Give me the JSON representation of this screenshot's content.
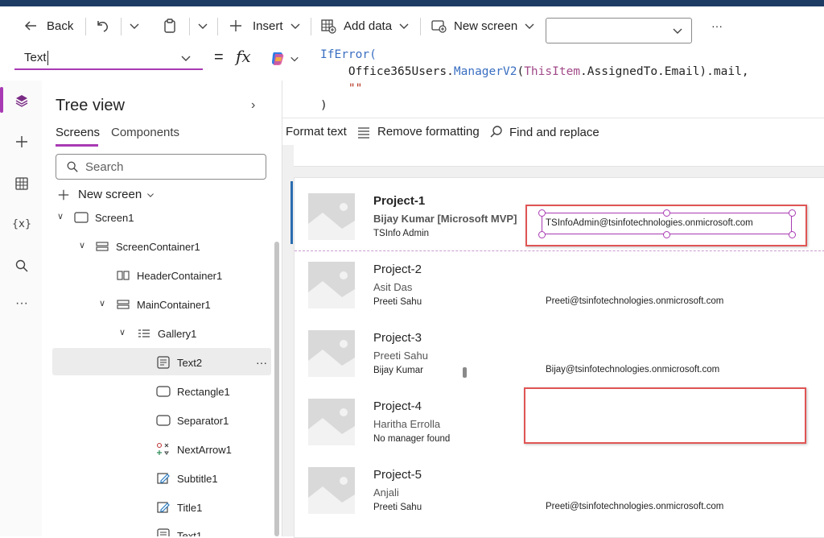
{
  "toolbar": {
    "back_label": "Back",
    "insert_label": "Insert",
    "add_data_label": "Add data",
    "new_screen_label": "New screen",
    "dropdown_value": "",
    "more_label": "···"
  },
  "formula_bar": {
    "property": "Text",
    "equals": "=",
    "fx": "fx",
    "code_lines": [
      "IfError(",
      "    Office365Users.ManagerV2(ThisItem.AssignedTo.Email).mail,",
      "    \"\"",
      ")"
    ]
  },
  "format_bar": {
    "format_text": "Format text",
    "remove_formatting": "Remove formatting",
    "find_replace": "Find and replace"
  },
  "tree_view": {
    "title": "Tree view",
    "tab_screens": "Screens",
    "tab_components": "Components",
    "search_placeholder": "Search",
    "new_screen": "New screen",
    "nodes": [
      {
        "label": "Screen1",
        "icon": "screen-icon"
      },
      {
        "label": "ScreenContainer1",
        "icon": "container-icon"
      },
      {
        "label": "HeaderContainer1",
        "icon": "horizontal-container-icon"
      },
      {
        "label": "MainContainer1",
        "icon": "container-icon"
      },
      {
        "label": "Gallery1",
        "icon": "gallery-icon"
      },
      {
        "label": "Text2",
        "icon": "text-icon"
      },
      {
        "label": "Rectangle1",
        "icon": "rectangle-icon"
      },
      {
        "label": "Separator1",
        "icon": "rectangle-icon"
      },
      {
        "label": "NextArrow1",
        "icon": "icon-control-icon"
      },
      {
        "label": "Subtitle1",
        "icon": "label-edit-icon"
      },
      {
        "label": "Title1",
        "icon": "label-edit-icon"
      },
      {
        "label": "Text1",
        "icon": "text-icon"
      }
    ],
    "more_options": "···"
  },
  "gallery": {
    "items": [
      {
        "title": "Project-1",
        "subtitle": "Bijay Kumar [Microsoft MVP]",
        "manager": "TSInfo Admin",
        "email": "TSInfoAdmin@tsinfotechnologies.onmicrosoft.com"
      },
      {
        "title": "Project-2",
        "subtitle": "Asit Das",
        "manager": "Preeti Sahu",
        "email": "Preeti@tsinfotechnologies.onmicrosoft.com"
      },
      {
        "title": "Project-3",
        "subtitle": "Preeti Sahu",
        "manager": "Bijay Kumar",
        "email": "Bijay@tsinfotechnologies.onmicrosoft.com"
      },
      {
        "title": "Project-4",
        "subtitle": "Haritha Errolla",
        "manager": "No manager found",
        "email": ""
      },
      {
        "title": "Project-5",
        "subtitle": "Anjali",
        "manager": "Preeti Sahu",
        "email": "Preeti@tsinfotechnologies.onmicrosoft.com"
      }
    ]
  },
  "colors": {
    "accent": "#a83ab3",
    "highlight_box": "#e05555",
    "selection_bar": "#2b6cb0"
  }
}
